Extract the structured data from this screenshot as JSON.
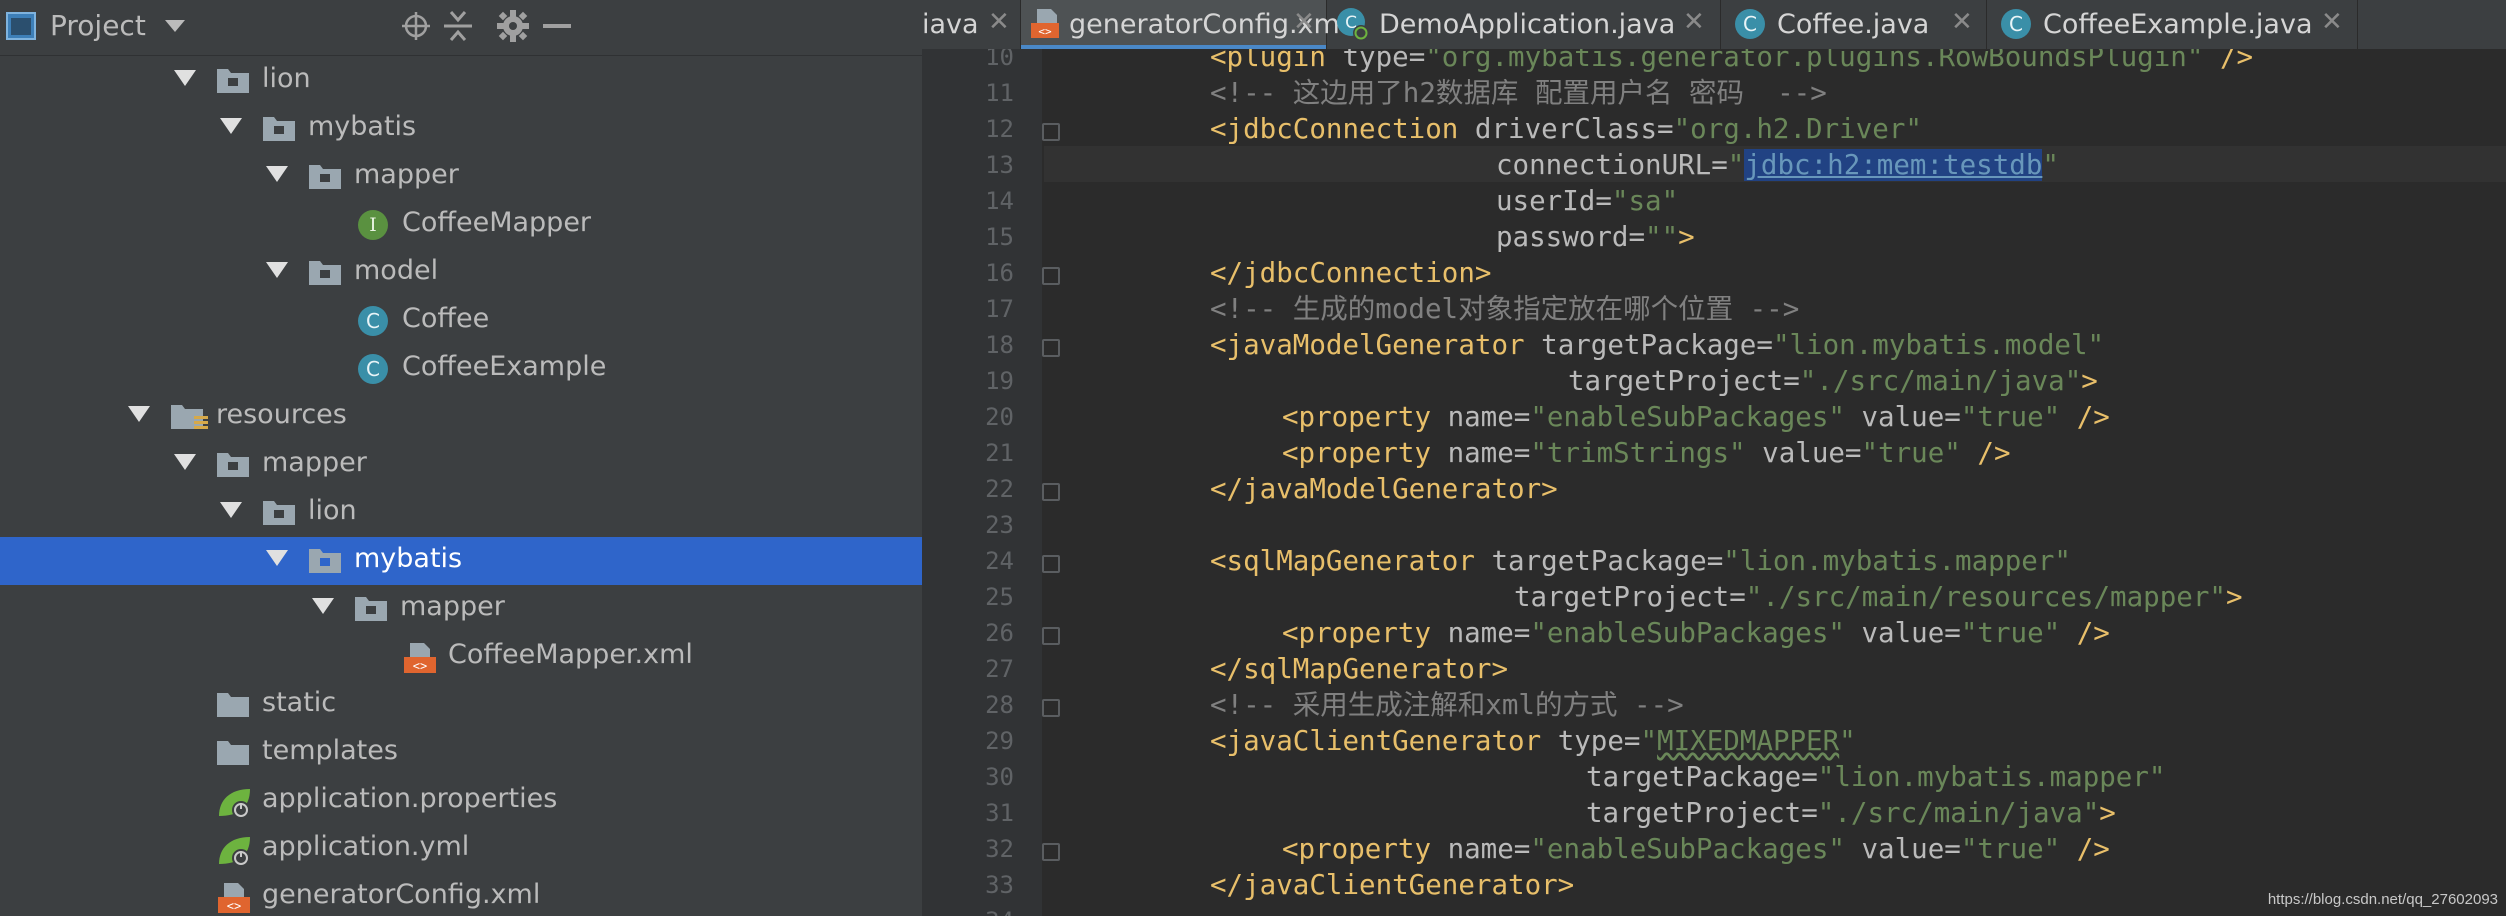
{
  "project_panel": {
    "title": "Project",
    "tree": [
      {
        "label": "lion",
        "type": "folder",
        "depth": 1,
        "expanded": true
      },
      {
        "label": "mybatis",
        "type": "folder",
        "depth": 2,
        "expanded": true
      },
      {
        "label": "mapper",
        "type": "folder",
        "depth": 3,
        "expanded": true
      },
      {
        "label": "CoffeeMapper",
        "type": "interface",
        "depth": 4
      },
      {
        "label": "model",
        "type": "folder",
        "depth": 3,
        "expanded": true
      },
      {
        "label": "Coffee",
        "type": "class",
        "depth": 4
      },
      {
        "label": "CoffeeExample",
        "type": "class",
        "depth": 4
      },
      {
        "label": "resources",
        "type": "resources-folder",
        "depth": 0,
        "expanded": true
      },
      {
        "label": "mapper",
        "type": "folder",
        "depth": 1,
        "expanded": true
      },
      {
        "label": "lion",
        "type": "folder",
        "depth": 2,
        "expanded": true
      },
      {
        "label": "mybatis",
        "type": "folder",
        "depth": 3,
        "expanded": true,
        "selected": true
      },
      {
        "label": "mapper",
        "type": "folder",
        "depth": 4,
        "expanded": true
      },
      {
        "label": "CoffeeMapper.xml",
        "type": "xml",
        "depth": 5
      },
      {
        "label": "static",
        "type": "folder",
        "depth": 1
      },
      {
        "label": "templates",
        "type": "folder",
        "depth": 1
      },
      {
        "label": "application.properties",
        "type": "spring-config",
        "depth": 1
      },
      {
        "label": "application.yml",
        "type": "spring-config",
        "depth": 1
      },
      {
        "label": "generatorConfig.xml",
        "type": "xml",
        "depth": 1
      }
    ]
  },
  "tabs": [
    {
      "label": "iava",
      "icon": "none"
    },
    {
      "label": "generatorConfig.xml",
      "icon": "xml-file-icon",
      "active": true
    },
    {
      "label": "DemoApplication.java",
      "icon": "spring-boot-class-icon"
    },
    {
      "label": "Coffee.java",
      "icon": "class-icon"
    },
    {
      "label": "CoffeeExample.java",
      "icon": "class-icon"
    }
  ],
  "editor": {
    "line_numbers": [
      "10",
      "11",
      "12",
      "13",
      "14",
      "15",
      "16",
      "17",
      "18",
      "19",
      "20",
      "21",
      "22",
      "23",
      "24",
      "25",
      "26",
      "27",
      "28",
      "29",
      "30",
      "31",
      "32",
      "33",
      "34"
    ],
    "lines": {
      "l10_tag": "<plugin",
      "l10_attr": " type=",
      "l10_val": "\"org.mybatis.generator.plugins.RowBoundsPlugin\"",
      "l10_end": " />",
      "l11": "<!-- 这边用了h2数据库 配置用户名 密码  -->",
      "l12_tag": "<jdbcConnection",
      "l12_attr": " driverClass=",
      "l12_val": "\"org.h2.Driver\"",
      "l13_attr": "connectionURL=",
      "l13_q1": "\"",
      "l13_sel": "jdbc:h2:mem:testdb",
      "l13_q2": "\"",
      "l14_attr": "userId=",
      "l14_val": "\"sa\"",
      "l15_attr": "password=",
      "l15_val": "\"\"",
      "l15_end": ">",
      "l16": "</jdbcConnection>",
      "l17": "<!-- 生成的model对象指定放在哪个位置 -->",
      "l18_tag": "<javaModelGenerator",
      "l18_attr": " targetPackage=",
      "l18_val": "\"lion.mybatis.model\"",
      "l19_attr": "targetProject=",
      "l19_val": "\"./src/main/java\"",
      "l19_end": ">",
      "l20_tag": "<property",
      "l20_attr": " name=",
      "l20_val": "\"enableSubPackages\"",
      "l20_attr2": " value=",
      "l20_val2": "\"true\"",
      "l20_end": " />",
      "l21_tag": "<property",
      "l21_attr": " name=",
      "l21_val": "\"trimStrings\"",
      "l21_attr2": " value=",
      "l21_val2": "\"true\"",
      "l21_end": " />",
      "l22": "</javaModelGenerator>",
      "l24_tag": "<sqlMapGenerator",
      "l24_attr": " targetPackage=",
      "l24_val": "\"lion.mybatis.mapper\"",
      "l25_attr": "targetProject=",
      "l25_val": "\"./src/main/resources/mapper\"",
      "l25_end": ">",
      "l26_tag": "<property",
      "l26_attr": " name=",
      "l26_val": "\"enableSubPackages\"",
      "l26_attr2": " value=",
      "l26_val2": "\"true\"",
      "l26_end": " />",
      "l27": "</sqlMapGenerator>",
      "l28": "<!-- 采用生成注解和xml的方式 -->",
      "l29_tag": "<javaClientGenerator",
      "l29_attr": " type=",
      "l29_q1": "\"",
      "l29_val": "MIXEDMAPPER",
      "l29_q2": "\"",
      "l30_attr": "targetPackage=",
      "l30_val": "\"lion.mybatis.mapper\"",
      "l31_attr": "targetProject=",
      "l31_val": "\"./src/main/java\"",
      "l31_end": ">",
      "l32_tag": "<property",
      "l32_attr": " name=",
      "l32_val": "\"enableSubPackages\"",
      "l32_attr2": " value=",
      "l32_val2": "\"true\"",
      "l32_end": " />",
      "l33": "</javaClientGenerator>"
    }
  },
  "watermark": "https://blog.csdn.net/qq_27602093",
  "colors": {
    "panel_bg": "#3c3f41",
    "editor_bg": "#2b2b2b",
    "selection": "#2f65ca",
    "xml_tag": "#e8bf6a",
    "xml_value": "#6a8759",
    "comment": "#808080"
  }
}
